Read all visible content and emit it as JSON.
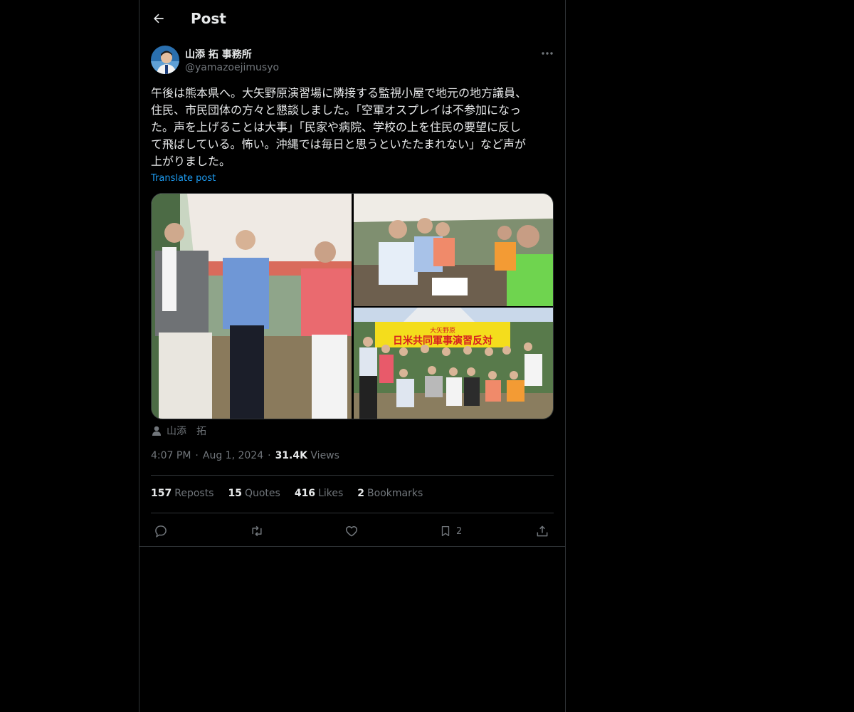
{
  "header": {
    "title": "Post",
    "back_icon": "arrow-left-icon"
  },
  "author": {
    "name": "山添 拓 事務所",
    "handle": "@yamazoejimusyo",
    "avatar_icon": "avatar"
  },
  "post": {
    "text": "午後は熊本県へ。大矢野原演習場に隣接する監視小屋で地元の地方議員、\n住民、市民団体の方々と懇談しました。「空軍オスプレイは不参加になっ\nた。声を上げることは大事」「民家や病院、学校の上を住民の要望に反し\nて飛ばしている。怖い。沖縄では毎日と思うといたたまれない」など声が\n上がりました。",
    "translate_label": "Translate post",
    "banner_text_1": "大矢野原",
    "banner_text_2": "日米共同軍事演習反対",
    "photo_credit": "山添　拓",
    "time": "4:07 PM",
    "date": "Aug 1, 2024",
    "views_count": "31.4K",
    "views_label": "Views",
    "separator": "·"
  },
  "stats": {
    "reposts_count": "157",
    "reposts_label": "Reposts",
    "quotes_count": "15",
    "quotes_label": "Quotes",
    "likes_count": "416",
    "likes_label": "Likes",
    "bookmarks_count": "2",
    "bookmarks_label": "Bookmarks"
  },
  "actions": {
    "bookmark_count": "2"
  },
  "colors": {
    "background": "#000000",
    "text": "#e7e9ea",
    "muted": "#71767b",
    "link": "#1d9bf0",
    "border": "#2f3336"
  }
}
